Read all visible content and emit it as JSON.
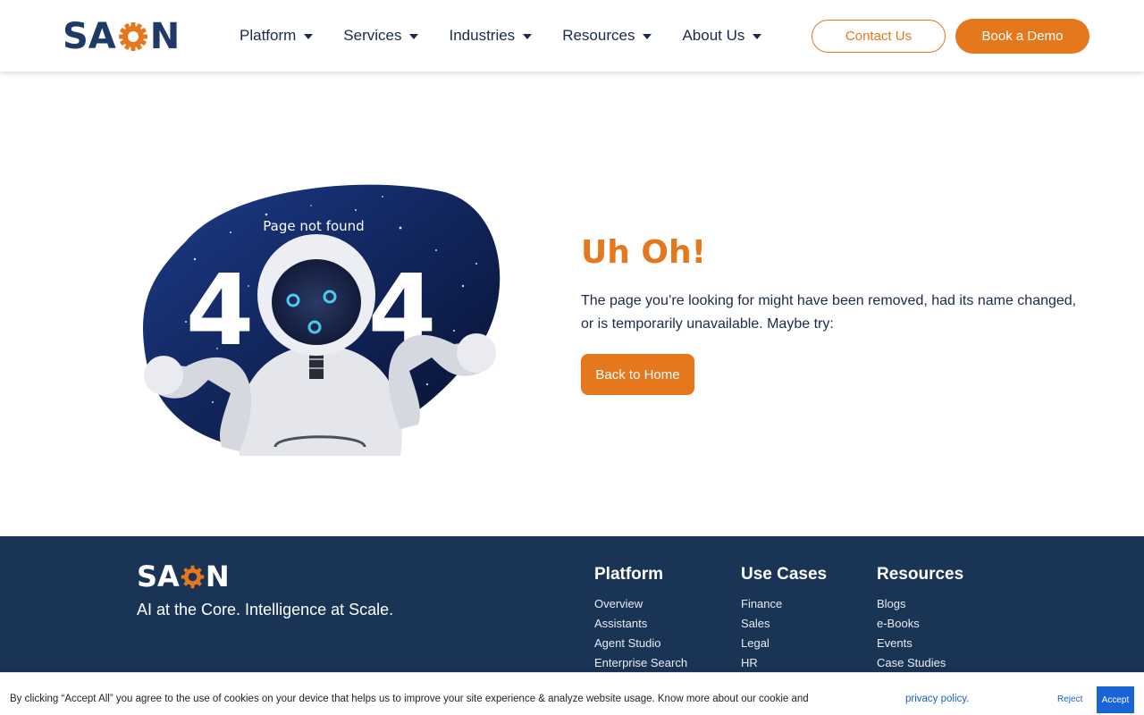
{
  "brand": {
    "name_left": "SA",
    "name_middle": "X",
    "name_right": "N",
    "logo_alt": "SAXON",
    "accent": "#e5771d",
    "navy": "#1f3a66"
  },
  "nav": {
    "items": [
      {
        "label": "Platform"
      },
      {
        "label": "Services"
      },
      {
        "label": "Industries"
      },
      {
        "label": "Resources"
      },
      {
        "label": "About Us"
      }
    ],
    "contact_label": "Contact Us",
    "demo_label": "Book a Demo"
  },
  "error": {
    "illustration_caption": "Page not found",
    "code_left": "4",
    "code_right": "4",
    "heading": "Uh Oh!",
    "description": "The page you’re looking for might have been removed, had its name changed, or is temporarily unavailable. Maybe try:",
    "home_button": "Back to Home"
  },
  "footer": {
    "tagline": "AI at the Core. Intelligence at Scale.",
    "columns": [
      {
        "title": "Platform",
        "links": [
          "Overview",
          "Assistants",
          "Agent Studio",
          "Enterprise Search"
        ]
      },
      {
        "title": "Use Cases",
        "links": [
          "Finance",
          "Sales",
          "Legal",
          "HR"
        ]
      },
      {
        "title": "Resources",
        "links": [
          "Blogs",
          "e-Books",
          "Events",
          "Case Studies"
        ]
      }
    ]
  },
  "cookie": {
    "text": "By clicking “Accept All” you agree to the use of cookies on your device that helps us to improve your site experience & analyze website usage. Know more about our cookie and",
    "link": "privacy policy.",
    "reject": "Reject",
    "accept": "Accept"
  }
}
